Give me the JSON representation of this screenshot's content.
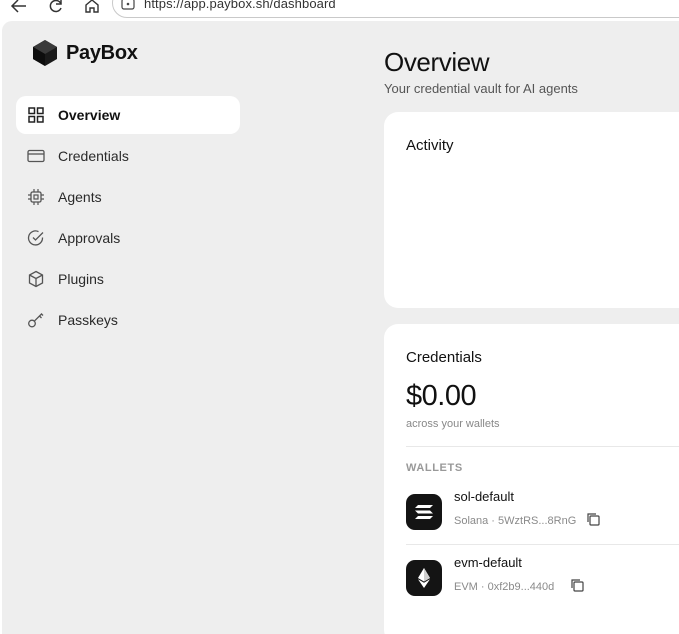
{
  "browser": {
    "url": "https://app.paybox.sh/dashboard"
  },
  "app": {
    "brand": "PayBox"
  },
  "sidebar": {
    "items": [
      {
        "label": "Overview",
        "icon": "grid-icon",
        "active": true
      },
      {
        "label": "Credentials",
        "icon": "card-icon",
        "active": false
      },
      {
        "label": "Agents",
        "icon": "chip-icon",
        "active": false
      },
      {
        "label": "Approvals",
        "icon": "check-circle-icon",
        "active": false
      },
      {
        "label": "Plugins",
        "icon": "cube-icon",
        "active": false
      },
      {
        "label": "Passkeys",
        "icon": "key-icon",
        "active": false
      }
    ]
  },
  "header": {
    "title": "Overview",
    "subtitle": "Your credential vault for AI agents"
  },
  "activity": {
    "title": "Activity"
  },
  "credentials": {
    "title": "Credentials",
    "balance": "$0.00",
    "balance_caption": "across your wallets",
    "wallets_heading": "WALLETS",
    "wallets": [
      {
        "name": "sol-default",
        "chain": "Solana",
        "address": "Solana · 5WztRS...8RnG",
        "icon": "solana-icon"
      },
      {
        "name": "evm-default",
        "chain": "EVM",
        "address": "EVM · 0xf2b9...440d",
        "icon": "ethereum-icon"
      }
    ]
  },
  "colors": {
    "shell_bg": "#eeeeee",
    "card_bg": "#ffffff",
    "wallet_icon_bg": "#141414"
  }
}
